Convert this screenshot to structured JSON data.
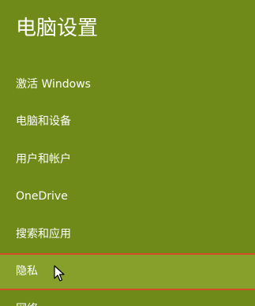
{
  "window": {
    "title": "电脑设置"
  },
  "nav": {
    "items": [
      {
        "label": "激活 Windows"
      },
      {
        "label": "电脑和设备"
      },
      {
        "label": "用户和帐户"
      },
      {
        "label": "OneDrive"
      },
      {
        "label": "搜索和应用"
      },
      {
        "label": "隐私",
        "selected": true
      },
      {
        "label": "网络"
      }
    ]
  },
  "colors": {
    "background": "#6f8a19",
    "selected_background": "#86a02b",
    "selected_border": "#d24d26",
    "text": "#ffffff"
  },
  "icons": {
    "pointer": "mouse-pointer-icon"
  }
}
